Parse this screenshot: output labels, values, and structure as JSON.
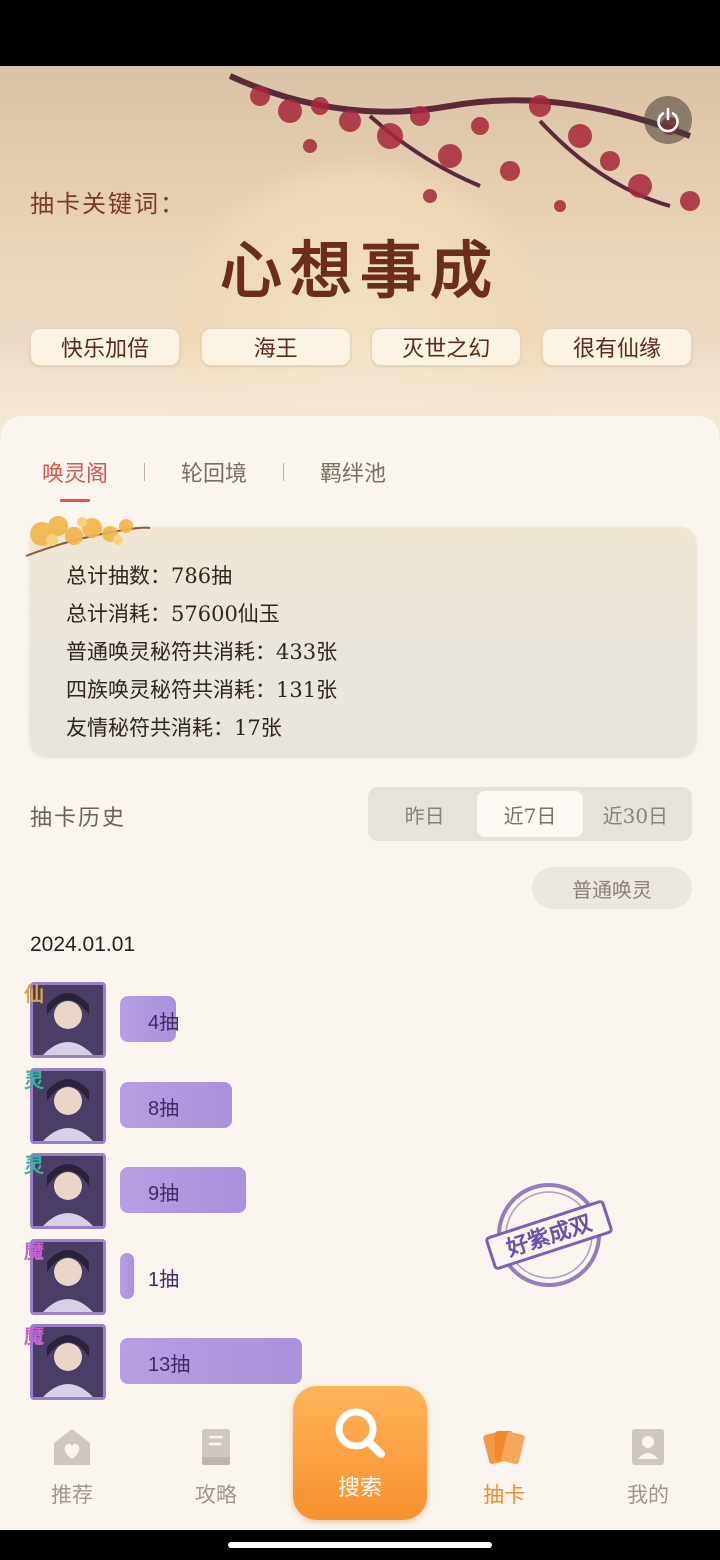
{
  "header": {
    "keyword_label": "抽卡关键词：",
    "keyword_main": "心想事成",
    "chips": [
      "快乐加倍",
      "海王",
      "灭世之幻",
      "很有仙缘"
    ]
  },
  "tabs": [
    "唤灵阁",
    "轮回境",
    "羁绊池"
  ],
  "active_tab": 0,
  "stats": [
    "总计抽数：786抽",
    "总计消耗：57600仙玉",
    "普通唤灵秘符共消耗：433张",
    "四族唤灵秘符共消耗：131张",
    "友情秘符共消耗：17张"
  ],
  "history": {
    "title": "抽卡历史",
    "ranges": [
      "昨日",
      "近7日",
      "近30日"
    ],
    "active_range": 1,
    "type_filter": "普通唤灵",
    "date": "2024.01.01",
    "entries": [
      {
        "race": "仙",
        "race_color": "#d9a93c",
        "count_label": "4抽",
        "pulls": 4
      },
      {
        "race": "灵",
        "race_color": "#38b3a0",
        "count_label": "8抽",
        "pulls": 8
      },
      {
        "race": "灵",
        "race_color": "#38b3a0",
        "count_label": "9抽",
        "pulls": 9
      },
      {
        "race": "魔",
        "race_color": "#c165d1",
        "count_label": "1抽",
        "pulls": 1
      },
      {
        "race": "魔",
        "race_color": "#c165d1",
        "count_label": "13抽",
        "pulls": 13
      }
    ],
    "stamp_text": "好紫成双"
  },
  "nav": {
    "items": [
      "推荐",
      "攻略",
      "搜索",
      "抽卡",
      "我的"
    ],
    "active": 3
  },
  "colors": {
    "accent": "#f08a2c",
    "tab_active": "#d9534f",
    "bar": "#b79fe3"
  }
}
